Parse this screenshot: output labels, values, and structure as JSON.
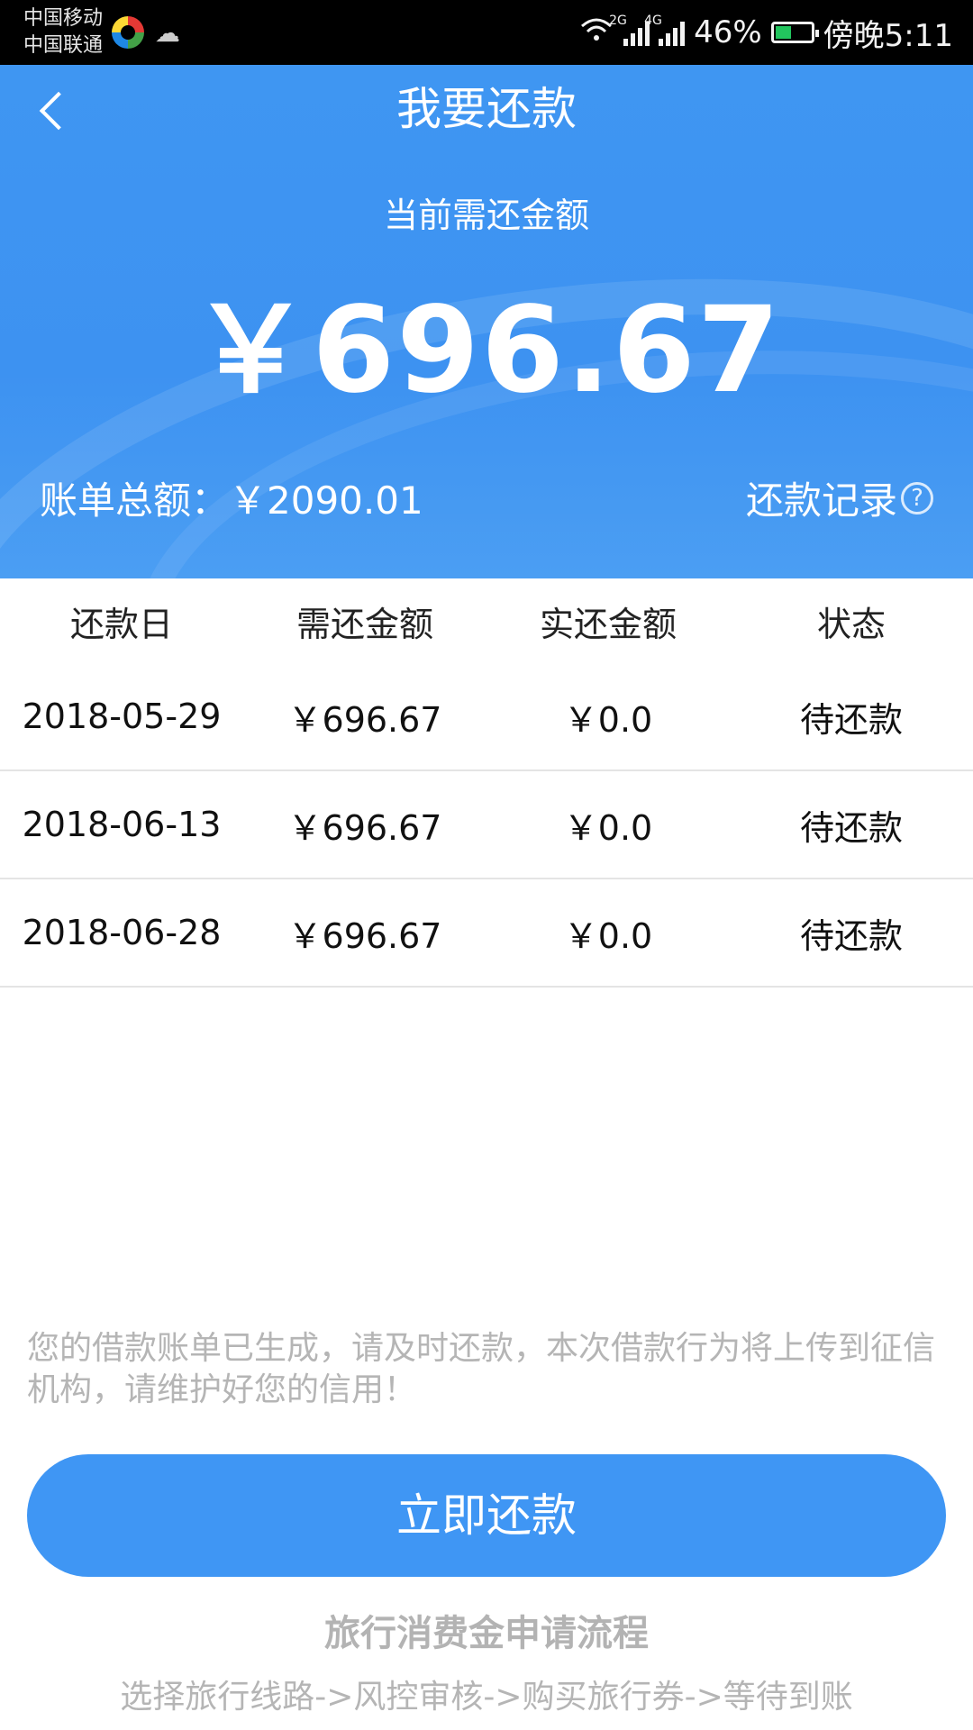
{
  "status_bar": {
    "carrier1": "中国移动",
    "carrier2": "中国联通",
    "net1": "2G",
    "net2": "4G",
    "battery": "46%",
    "battery_level": 0.46,
    "time": "傍晚5:11"
  },
  "header": {
    "title": "我要还款",
    "due_label": "当前需还金额",
    "due_amount": "￥696.67",
    "total_label": "账单总额：",
    "total_amount": "￥2090.01",
    "records_link": "还款记录",
    "help": "?"
  },
  "table": {
    "columns": [
      "还款日",
      "需还金额",
      "实还金额",
      "状态"
    ],
    "rows": [
      {
        "date": "2018-05-29",
        "due": "￥696.67",
        "paid": "￥0.0",
        "status": "待还款"
      },
      {
        "date": "2018-06-13",
        "due": "￥696.67",
        "paid": "￥0.0",
        "status": "待还款"
      },
      {
        "date": "2018-06-28",
        "due": "￥696.67",
        "paid": "￥0.0",
        "status": "待还款"
      }
    ]
  },
  "notice": "您的借款账单已生成，请及时还款，本次借款行为将上传到征信机构，请维护好您的信用！",
  "pay_button": "立即还款",
  "flow": {
    "title": "旅行消费金申请流程",
    "steps": "选择旅行线路->风控审核->购买旅行券->等待到账"
  },
  "colors": {
    "accent": "#3f96f4",
    "status_bar": "#000000"
  }
}
